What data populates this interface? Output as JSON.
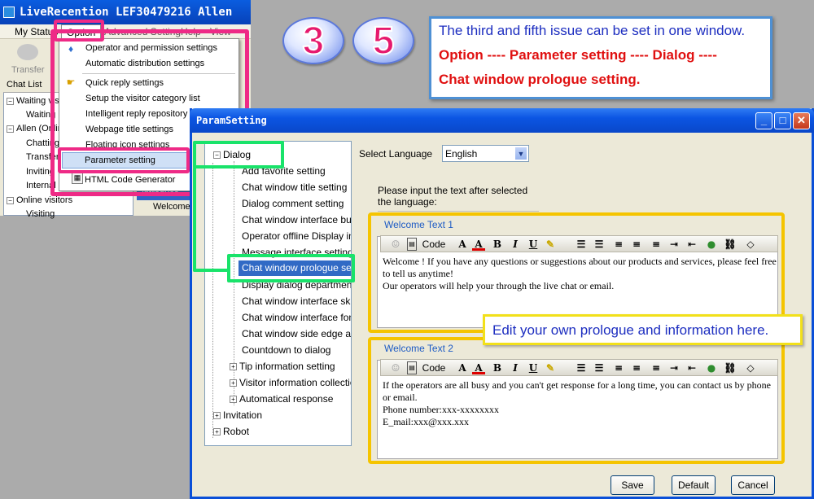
{
  "app_window": {
    "title": "LiveRecention  LEF30479216 Allen",
    "menu": [
      "My Status",
      "Option",
      "Advanced Setting",
      "Help",
      "View"
    ],
    "toolbar_transfer": "Transfer",
    "chat_list_header": "Chat List",
    "tree": [
      {
        "label": "Waiting visitors",
        "level": 0,
        "expanded": true
      },
      {
        "label": "Waiting",
        "level": 1
      },
      {
        "label": "Allen (Online)",
        "level": 0,
        "expanded": true
      },
      {
        "label": "Chatting",
        "level": 1
      },
      {
        "label": "Transfer",
        "level": 1
      },
      {
        "label": "Inviting",
        "level": 1
      },
      {
        "label": "Internal",
        "level": 1
      },
      {
        "label": "Online visitors",
        "level": 0,
        "expanded": true
      },
      {
        "label": "Visiting",
        "level": 1
      }
    ],
    "intro_tab": "Introduce",
    "welcome_item": "Welcome"
  },
  "option_menu": {
    "items": [
      {
        "label": "Operator and permission settings",
        "icon": "operator-icon"
      },
      {
        "label": "Automatic distribution settings",
        "icon": ""
      },
      {
        "label": "Quick reply settings",
        "icon": "hand-icon"
      },
      {
        "label": "Setup the visitor category list",
        "icon": ""
      },
      {
        "label": "Intelligent reply repository",
        "icon": ""
      },
      {
        "label": "Webpage title settings",
        "icon": ""
      },
      {
        "label": "Floating icon settings",
        "icon": ""
      },
      {
        "label": "Parameter setting",
        "icon": ""
      },
      {
        "label": "HTML Code Generator",
        "icon": "html-generator-icon"
      }
    ]
  },
  "bubbles": [
    "3",
    "5"
  ],
  "info_callout": {
    "line1": "The third and fifth issue can be set in one window.",
    "line2": "Option ---- Parameter setting ---- Dialog ----",
    "line3": "Chat window prologue setting."
  },
  "param_window": {
    "title": "ParamSetting",
    "tree": [
      {
        "label": "Dialog",
        "level": 0,
        "expanded": true
      },
      {
        "label": "Add favorite setting",
        "level": 1
      },
      {
        "label": "Chat window title setting",
        "level": 1
      },
      {
        "label": "Dialog comment setting",
        "level": 1
      },
      {
        "label": "Chat window interface button setting",
        "level": 1
      },
      {
        "label": "Operator offline Display interface",
        "level": 1
      },
      {
        "label": "Message interface setting",
        "level": 1
      },
      {
        "label": "Chat window prologue setting",
        "level": 1,
        "selected": true
      },
      {
        "label": "Display dialog department",
        "level": 1
      },
      {
        "label": "Chat window interface skin",
        "level": 1
      },
      {
        "label": "Chat window interface font",
        "level": 1
      },
      {
        "label": "Chat window side edge ad",
        "level": 1
      },
      {
        "label": "Countdown to dialog",
        "level": 1
      },
      {
        "label": "Tip information setting",
        "level": 1,
        "expandable": true
      },
      {
        "label": "Visitor information collection",
        "level": 1,
        "expandable": true
      },
      {
        "label": "Automatical response",
        "level": 1,
        "expandable": true
      },
      {
        "label": "Invitation",
        "level": 0,
        "expandable": true
      },
      {
        "label": "Robot",
        "level": 0,
        "expandable": true
      }
    ],
    "select_language_label": "Select Language",
    "language_value": "English",
    "hint": "Please input the text after selected the language:",
    "welcome1": {
      "label": "Welcome Text 1",
      "text": [
        "Welcome ! If you have any questions or suggestions about our products and services, please feel free",
        "to tell us anytime!",
        "Our operators will help your through the live chat or email."
      ]
    },
    "welcome2": {
      "label": "Welcome Text 2",
      "text": [
        "If the operators are all busy and you can't get response for a long time, you can contact us by phone",
        "or email.",
        "Phone number:xxx-xxxxxxxx",
        "E_mail:xxx@xxx.xxx"
      ]
    },
    "toolbar": {
      "code_label": "Code",
      "bold": "B",
      "italic": "I",
      "underline": "U"
    },
    "buttons": {
      "save": "Save",
      "default": "Default",
      "cancel": "Cancel"
    }
  },
  "edit_callout": "Edit your own prologue and information here.",
  "colors": {
    "pink_highlight": "#ee2a86",
    "green_highlight": "#19e36a",
    "yellow_highlight": "#f5c400",
    "title_blue": "#0b55e3",
    "callout_blue_text": "#1d2ec0",
    "callout_red_text": "#e01010"
  }
}
